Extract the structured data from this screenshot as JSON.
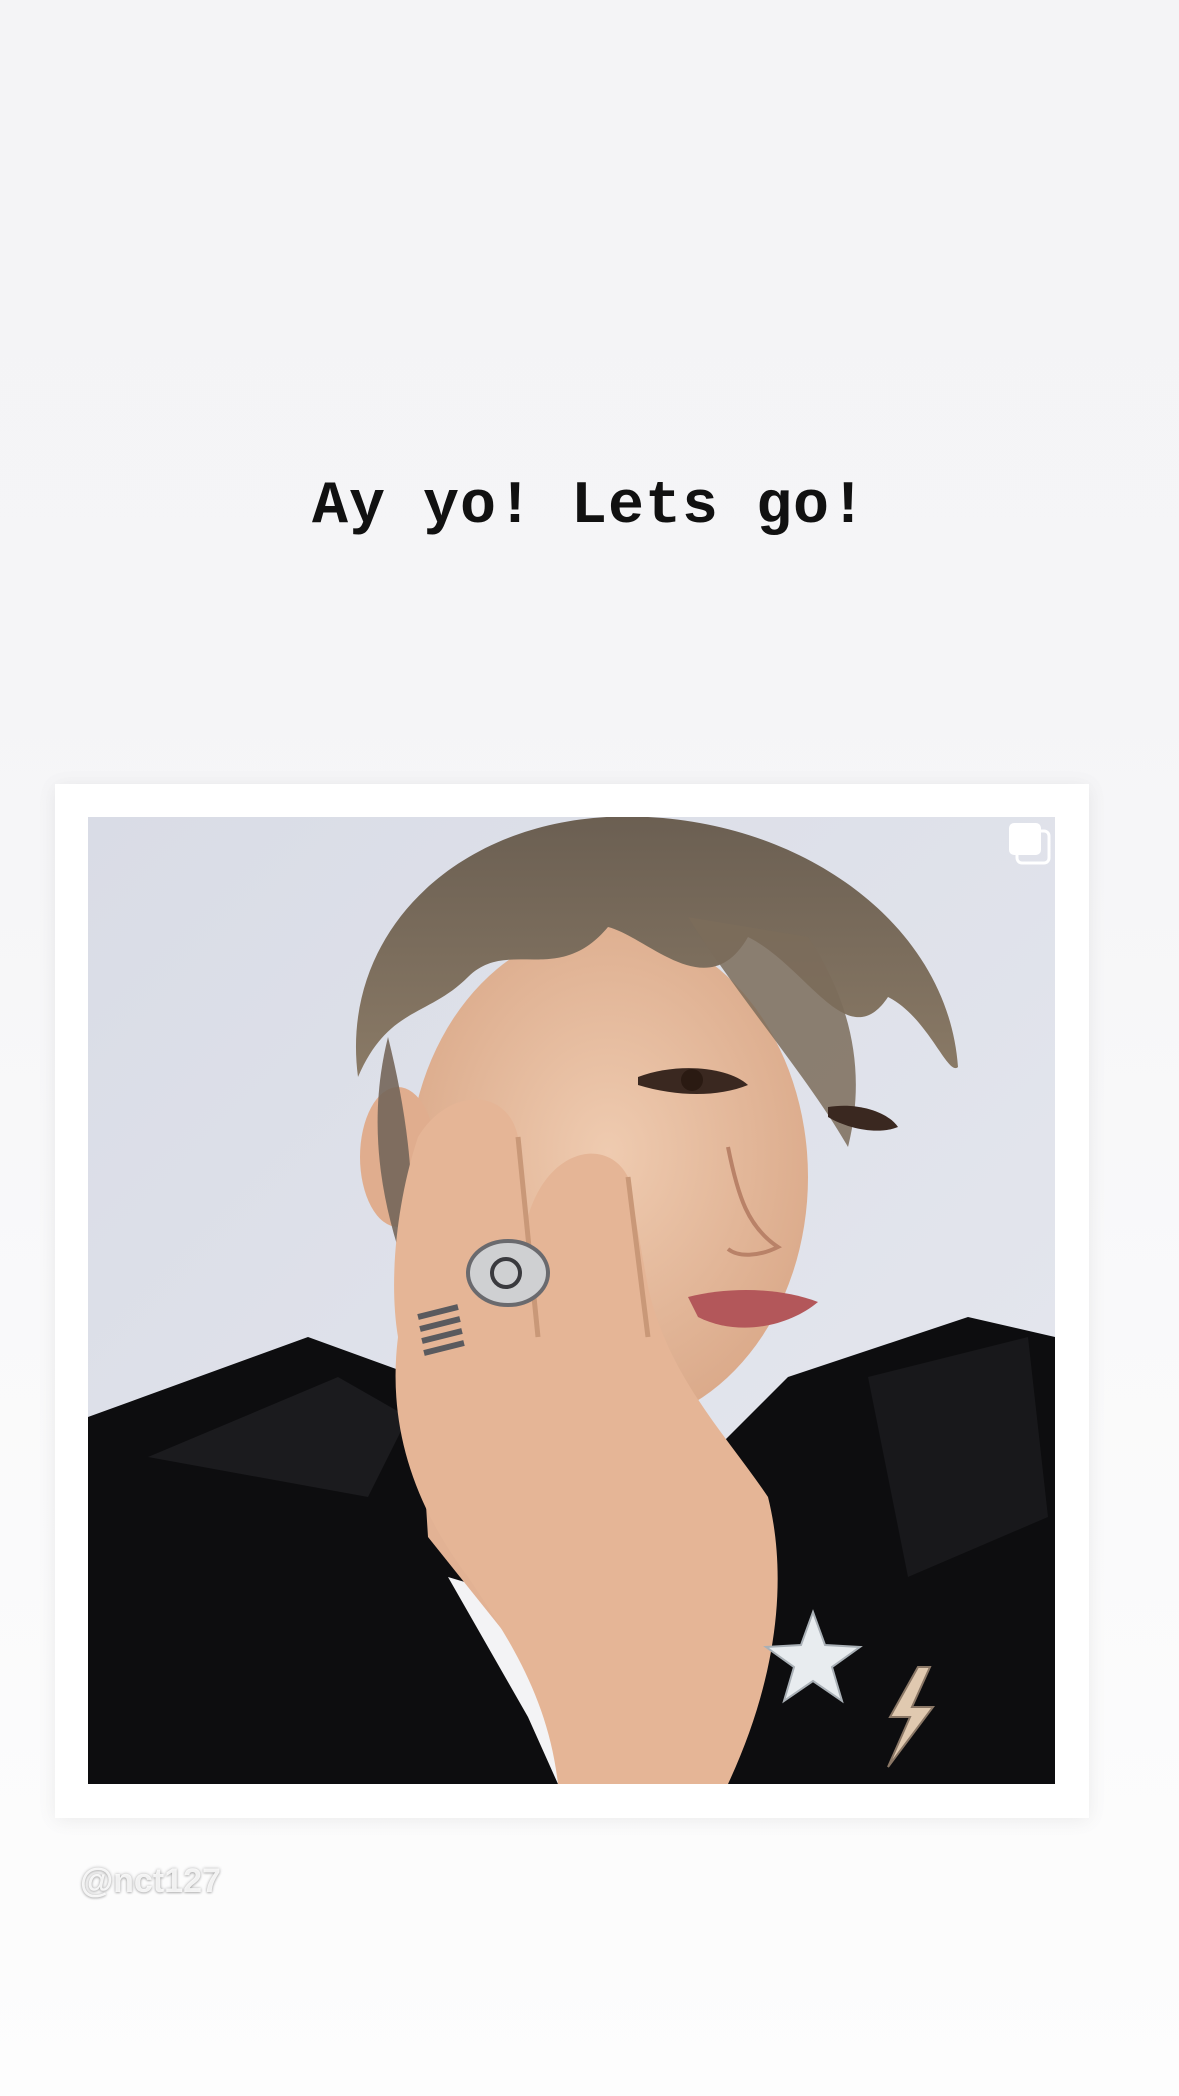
{
  "story": {
    "caption": "Ay yo! Lets go!",
    "mention": "@nct127"
  },
  "post": {
    "photo_alt": "Portrait photo",
    "carousel_icon": "multiple-photos-icon"
  },
  "colors": {
    "background": "#f5f5f7",
    "card": "#ffffff",
    "text": "#111111"
  }
}
